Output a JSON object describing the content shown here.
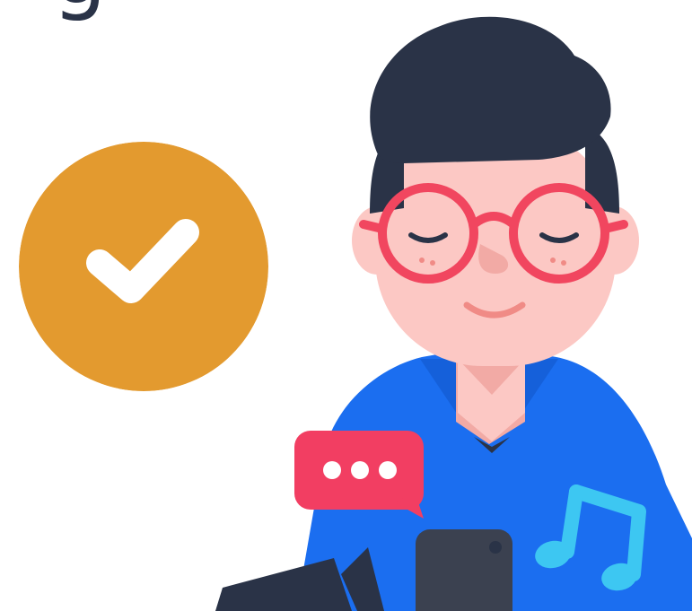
{
  "headline_fragment": "g",
  "colors": {
    "badge": "#e39a2f",
    "check_mark": "#ffffff",
    "hair": "#2a3347",
    "skin": "#fcc8c4",
    "skin_shadow": "#f2aaa5",
    "glasses": "#f1465f",
    "hoodie": "#1b6ef0",
    "chat_bubble": "#f23e62",
    "music_note": "#3dc7f2",
    "phone": "#3b4150"
  },
  "icons": {
    "badge": "check-circle-icon",
    "chat": "chat-bubble-ellipsis-icon",
    "music": "music-note-icon",
    "video": "video-camera-icon",
    "phone": "smartphone-icon"
  }
}
